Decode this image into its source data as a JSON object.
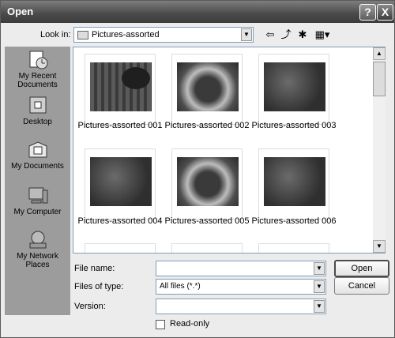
{
  "window": {
    "title": "Open",
    "help_label": "?",
    "close_label": "X"
  },
  "toolbar": {
    "look_in_label": "Look in:",
    "look_in_value": "Pictures-assorted",
    "back_icon": "back-arrow-icon",
    "up_icon": "up-folder-icon",
    "new_folder_icon": "new-folder-icon",
    "views_icon": "views-menu-icon"
  },
  "places": [
    {
      "label": "My Recent Documents",
      "icon": "recent-documents-icon"
    },
    {
      "label": "Desktop",
      "icon": "desktop-icon"
    },
    {
      "label": "My Documents",
      "icon": "my-documents-icon"
    },
    {
      "label": "My Computer",
      "icon": "my-computer-icon"
    },
    {
      "label": "My Network Places",
      "icon": "network-places-icon"
    }
  ],
  "files": [
    {
      "name": "Pictures-assorted 001"
    },
    {
      "name": "Pictures-assorted 002"
    },
    {
      "name": "Pictures-assorted 003"
    },
    {
      "name": "Pictures-assorted 004"
    },
    {
      "name": "Pictures-assorted 005"
    },
    {
      "name": "Pictures-assorted 006"
    }
  ],
  "form": {
    "file_name_label": "File name:",
    "file_name_value": "",
    "file_type_label": "Files of type:",
    "file_type_value": "All files (*.*)",
    "version_label": "Version:",
    "version_value": "",
    "readonly_label": "Read-only"
  },
  "buttons": {
    "open": "Open",
    "cancel": "Cancel"
  },
  "colors": {
    "titlebar": "#4a4a4a",
    "places_bar": "#9c9c9c"
  }
}
